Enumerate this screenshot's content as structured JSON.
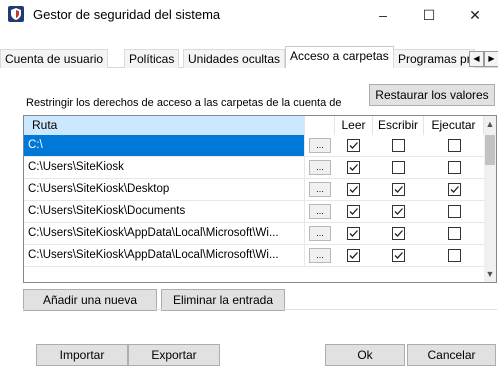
{
  "window": {
    "title": "Gestor de seguridad del sistema",
    "minimize": "–",
    "maximize": "☐",
    "close": "✕"
  },
  "tabs": [
    {
      "label": "Cuenta de usuario"
    },
    {
      "label": "Políticas"
    },
    {
      "label": "Unidades ocultas"
    },
    {
      "label": "Acceso a carpetas"
    },
    {
      "label": "Programas pro"
    }
  ],
  "tab_scroll": {
    "left": "◀",
    "right": "▶"
  },
  "main": {
    "caption": "Restringir los derechos de acceso a las carpetas de la cuenta de",
    "restore_button": "Restaurar los valores",
    "columns": {
      "path": "Ruta",
      "read": "Leer",
      "write": "Escribir",
      "execute": "Ejecutar"
    },
    "dots_label": "...",
    "rows": [
      {
        "path": "C:\\",
        "read": true,
        "write": false,
        "execute": false,
        "selected": true
      },
      {
        "path": "C:\\Users\\SiteKiosk",
        "read": true,
        "write": false,
        "execute": false
      },
      {
        "path": "C:\\Users\\SiteKiosk\\Desktop",
        "read": true,
        "write": true,
        "execute": true
      },
      {
        "path": "C:\\Users\\SiteKiosk\\Documents",
        "read": true,
        "write": true,
        "execute": false
      },
      {
        "path": "C:\\Users\\SiteKiosk\\AppData\\Local\\Microsoft\\Wi...",
        "read": true,
        "write": true,
        "execute": false
      },
      {
        "path": "C:\\Users\\SiteKiosk\\AppData\\Local\\Microsoft\\Wi...",
        "read": true,
        "write": true,
        "execute": false
      }
    ],
    "add_button": "Añadir una nueva",
    "delete_button": "Eliminar la entrada"
  },
  "footer": {
    "import_button": "Importar",
    "export_button": "Exportar",
    "ok_button": "Ok",
    "cancel_button": "Cancelar"
  },
  "colors": {
    "selection": "#0078d7",
    "header_highlight": "#cce8ff",
    "app_icon": "#1f3b73"
  }
}
